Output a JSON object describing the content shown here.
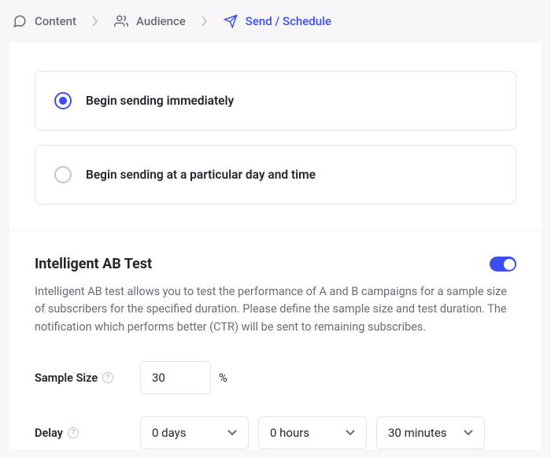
{
  "breadcrumb": {
    "content": "Content",
    "audience": "Audience",
    "send_schedule": "Send / Schedule"
  },
  "send_options": {
    "immediate": "Begin sending immediately",
    "scheduled": "Begin sending at a particular day and time"
  },
  "ab_test": {
    "title": "Intelligent AB Test",
    "description": "Intelligent AB test allows you to test the performance of A and B campaigns for a sample size of subscribers for the specified duration. Please define the sample size and test duration. The notification which performs better (CTR) will be sent to remaining subscribes.",
    "sample_size_label": "Sample Size",
    "sample_size_value": "30",
    "sample_size_unit": "%",
    "delay_label": "Delay",
    "delay_days": "0 days",
    "delay_hours": "0 hours",
    "delay_minutes": "30 minutes"
  }
}
